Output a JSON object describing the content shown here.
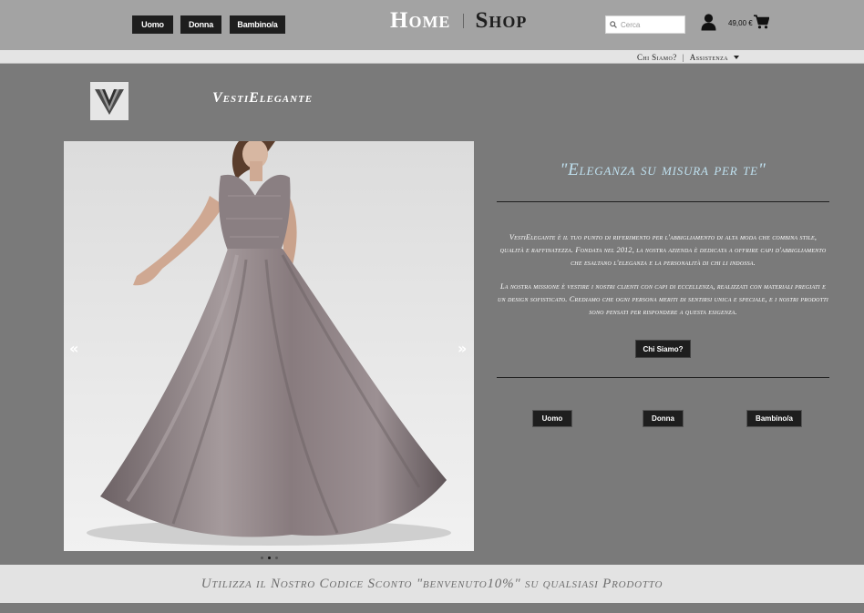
{
  "header": {
    "nav": [
      "Uomo",
      "Donna",
      "Bambino/a"
    ],
    "brand_home": "Home",
    "brand_shop": "Shop",
    "search_placeholder": "Cerca",
    "cart_total": "49,00 €",
    "icons": {
      "search": "search-icon",
      "user": "user-icon",
      "cart": "cart-icon"
    }
  },
  "subnav": {
    "about": "Chi Siamo?",
    "separator": "|",
    "support": "Assistenza"
  },
  "company": {
    "name": "VestiElegante",
    "logo": "VE monogram logo"
  },
  "carousel": {
    "prev": "«",
    "next": "»",
    "slides": 3,
    "active_slide": 2
  },
  "content": {
    "tagline": "\"Eleganza su misura per te\"",
    "about_p1": "VestiElegante è il tuo punto di riferimento per l'abbigliamento di alta moda che combina stile, qualità e raffinatezza. Fondata nel 2012, la nostra azienda è dedicata a offrire capi d'abbigliamento che esaltano l'eleganza e la personalità di chi li indossa.",
    "about_p2": "La nostra missione è vestire i nostri clienti con capi di eccellenza, realizzati con materiali pregiati e un design sofisticato. Crediamo che ogni persona meriti di sentirsi unica e speciale, e i nostri prodotti sono pensati per rispondere a questa esigenza.",
    "about_button": "Chi Siamo?",
    "categories": [
      "Uomo",
      "Donna",
      "Bambino/a"
    ]
  },
  "promo": {
    "text": "Utilizza il Nostro Codice Sconto \"benvenuto10%\" su qualsiasi Prodotto"
  },
  "colors": {
    "header_bg": "#a3a3a3",
    "page_bg": "#7a7a7a",
    "button_bg": "#1e1e1e",
    "tagline": "#bfe0ef"
  }
}
